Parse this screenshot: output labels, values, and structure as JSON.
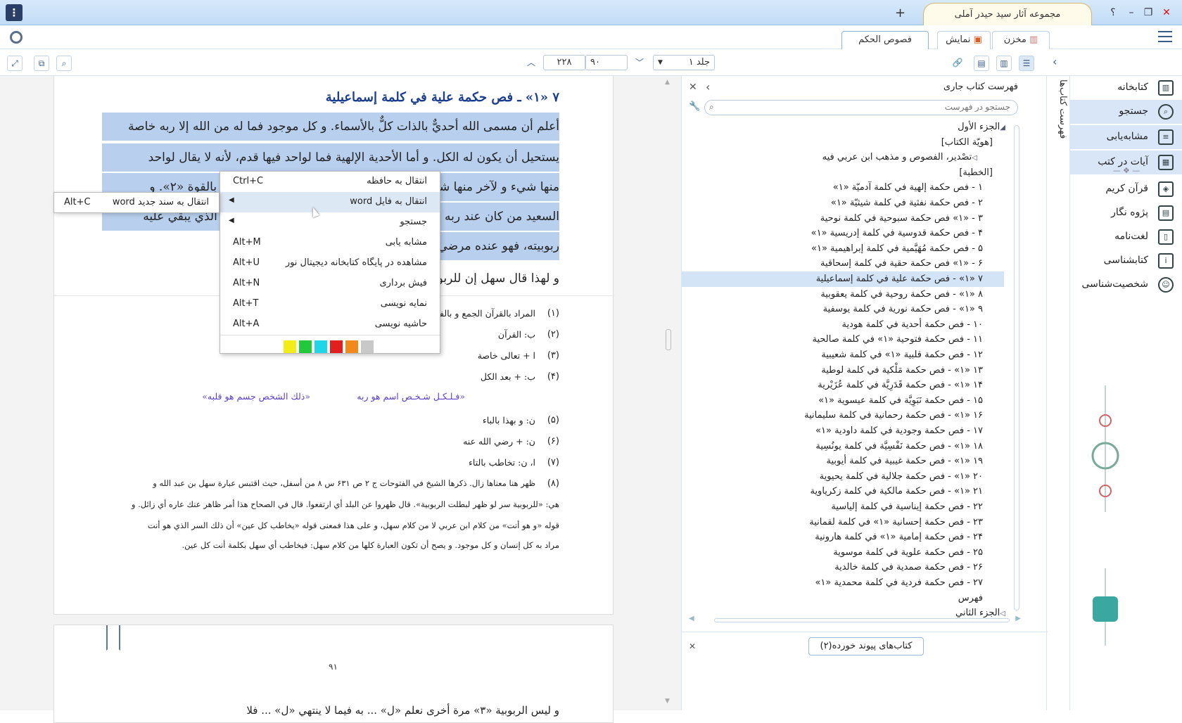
{
  "titlebar": {
    "app_tab": "مجموعه آثار سید حیدر آملی",
    "add_tab": "+",
    "help": "؟",
    "minimize": "–",
    "restore": "❐",
    "close": "✕",
    "menu": "⋮"
  },
  "top_tabs": [
    {
      "label": "مخزن"
    },
    {
      "label": "نمایش"
    },
    {
      "label": "فصوص الحكم"
    }
  ],
  "toolbar": {
    "volume": "جلد ۱",
    "page_from": "۹۰",
    "page_to": "۲۲۸"
  },
  "sidebar": {
    "items": [
      {
        "label": "کتابخانه",
        "icon": "library-icon"
      },
      {
        "label": "جستجو",
        "icon": "search-icon"
      },
      {
        "label": "مشابه‌یابی",
        "icon": "similar-icon"
      },
      {
        "label": "آیات در کتب",
        "icon": "verses-icon"
      },
      {
        "label": "قرآن کریم",
        "icon": "quran-icon"
      },
      {
        "label": "پژوه نگار",
        "icon": "notes-icon"
      },
      {
        "label": "لغت‌نامه",
        "icon": "dictionary-icon"
      },
      {
        "label": "کتابشناسی",
        "icon": "bibliography-icon"
      },
      {
        "label": "شخصیت‌شناسی",
        "icon": "person-icon"
      }
    ],
    "vertical_tab": "فهرست کتاب‌ها"
  },
  "toc": {
    "title": "فهرست کتاب جاری",
    "search_placeholder": "جستجو در فهرست",
    "items": [
      "الجزء الأول",
      "[هويّة الكتاب]",
      "تصْدير، الفصوص و مذهب ابن عربي فيه",
      "[الخطبة]",
      "۱ - فص حكمة إلهية في كلمة آدميّة «۱»",
      "۲ - فص حكمة نفثية في كلمة شيثيّة «۱»",
      "۳ - «۱» فص حكمة سبوحية في كلمة نوحية",
      "۴ - فص حكمة قدوسية في كلمة إدريسية «۱»",
      "۵ - فص حكمة مُهَيَّمية في كلمة إبراهيمية «۱»",
      "۶ - «۱» فص حكمة حقية في كلمة إسحاقية",
      "۷ «۱» - فص حكمة علية في كلمة إسماعيلية",
      "۸ «۱» - فص حكمة روحية في كلمة يعقوبية",
      "۹ «۱» - فص حكمة نورية في كلمة يوسفية",
      "۱۰ - فص حكمة أحدية في كلمة هودية",
      "۱۱ - فص حكمة فتوحية «۱» في كلمة صالحية",
      "۱۲ - فص حكمة قلبية «۱» في كلمة شعيبية",
      "۱۳ «۱» - فص حكمة مَلْكية في كلمة لوطية",
      "۱۴ «۱» - فص حكمة قَدَرِيَّة في كلمة عُزَيْرية",
      "۱۵ - فص حكمة نَبَوِيَّة في كلمة عيسوية «۱»",
      "۱۶ «۱» - فص حكمة رحمانية في كلمة سليمانية",
      "۱۷ - فص حكمة وجودية في كلمة داودية «۱»",
      "۱۸ «۱» - فص حكمة نَفْسِيَّة في كلمة يونُسِية",
      "۱۹ «۱» - فص حكمة غيبية في كلمة أيوبية",
      "۲۰ «۱» - فص حكمة جلالية في كلمة يحيوية",
      "۲۱ «۱» - فص حكمة مالكية في كلمة زكرياوية",
      "۲۲ - فص حكمة إيناسية في كلمة إلياسية",
      "۲۳ - فص حكمة إحسانية «۱» في كلمة لقمانية",
      "۲۴ - فص حكمة إمامية «۱» في كلمة هارونية",
      "۲۵ - فص حكمة علوية في كلمة موسوية",
      "۲۶ - فص حكمة صمدية في كلمة خالدية",
      "۲۷ - فص حكمة فردية في كلمة محمدية «۱»",
      "فهرس",
      "الجزء الثاني"
    ],
    "linked_books": "کتاب‌های پیوند خورده(۲)"
  },
  "document": {
    "heading": "۷ «۱» ـ فص حكمة علية في كلمة إسماعيلية",
    "lines": [
      "أعلم أن مسمى الله أحديٌّ بالذات كلٌّ بالأسماء. و كل موجود فما له من الله إلا ربه خاصة",
      "يستحيل أن يكون له الكل. و أما الأحدية الإلهية فما لواحد فيها قدم، لأنه لا يقال لواحد",
      "منها شيء و لآخر منها شيء لأنها لا تقبل التبعيض. فأحديته مجموع كله بالقوة «۲». و",
      "السعيد من كان عند ربه مرضياً، و ما ثَمَّ إلا من هو مرضي عند ربه لأنه الذي يبقي عليه",
      "ربوبيته، فهو عنده مرضي فهو سعيد.",
      "و لهذا قال سهل إن للربوبية سراً لو ظهر"
    ],
    "footnotes": [
      {
        "num": "(۱)",
        "text": "المراد بالقرآن الجمع و بالفرقان التفريق"
      },
      {
        "num": "(۲)",
        "text": "ب: القرآن"
      },
      {
        "num": "(۳)",
        "text": "ا + تعالى خاصة"
      },
      {
        "num": "(۴)",
        "text": "ب: + بعد الكل"
      },
      {
        "num": "(۵)",
        "text": "ن: و بهذا بالباء"
      },
      {
        "num": "(۶)",
        "text": "ن: + رضي الله عنه"
      },
      {
        "num": "(۷)",
        "text": "ا، ن: تخاطب بالتاء"
      },
      {
        "num": "(۸)",
        "text": "ظهر هنا معناها زال. ذكرها الشيخ في الفتوحات ج ۲ ص ۶۳۱ س ۸ من أسفل، حيث اقتبس عبارة سهل بن عبد الله و"
      }
    ],
    "footnote_cont": [
      "هي: «للربوبية سر لو ظهر لبطلت الربوبية». قال ظهروا عن البلد أي ارتفعوا. قال في الصحاح هذا أمر ظاهر عنك عاره أي زائل. و",
      "قوله «و هو أنت» من كلام ابن عربي لا من كلام سهل، و على هذا فمعنى قوله «يخاطب كل عين» أن ذلك السر الذي هو أنت",
      "مراد به كل إنسان و كل موجود. و يصح أن تكون العبارة كلها من كلام سهل: فيخاطب أي سهل بكلمة أنت كل عين."
    ],
    "verse_left": "«ذلك الشخص جسم هو قلبه»",
    "verse_right": "«فـلـكـل شـخـص اسم هو ربه",
    "page_number": "۹۱",
    "page2_line": "و ليس الربوبية «۳» مرة أخرى نعلم «ل» ... به فيما لا ينتهي «ل» ... فلا"
  },
  "context_menu": {
    "items": [
      {
        "label": "انتقال به حافظه",
        "shortcut": "Ctrl+C"
      },
      {
        "label": "انتقال به فایل word",
        "shortcut": ""
      },
      {
        "label": "جستجو",
        "shortcut": ""
      },
      {
        "label": "مشابه یابی",
        "shortcut": "Alt+M"
      },
      {
        "label": "مشاهده در پایگاه کتابخانه دیجیتال نور",
        "shortcut": "Alt+U"
      },
      {
        "label": "فیش برداری",
        "shortcut": "Alt+N"
      },
      {
        "label": "نمایه نویسی",
        "shortcut": "Alt+T"
      },
      {
        "label": "حاشیه نویسی",
        "shortcut": "Alt+A"
      }
    ],
    "swatch_colors": [
      "#f2ec18",
      "#22c93a",
      "#21d5e8",
      "#e21f1f",
      "#f08a1d",
      "#c8c8c8"
    ]
  },
  "submenu": {
    "label": "انتقال به سند جدید word",
    "shortcut": "Alt+C"
  }
}
